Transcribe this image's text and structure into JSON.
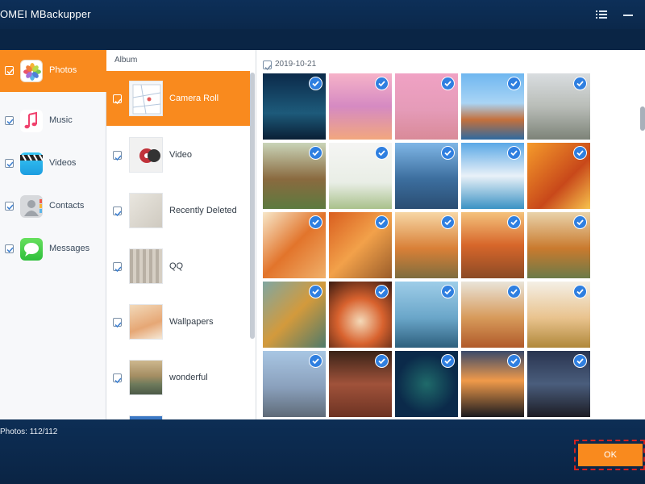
{
  "window": {
    "title": "OMEI MBackupper"
  },
  "icons": {
    "menu": "list-menu-icon",
    "minimize": "minimize-icon"
  },
  "categories": [
    {
      "label": "Photos",
      "icon": "photos-app-icon"
    },
    {
      "label": "Music",
      "icon": "music-note-icon"
    },
    {
      "label": "Videos",
      "icon": "video-clapper-icon"
    },
    {
      "label": "Contacts",
      "icon": "contacts-app-icon"
    },
    {
      "label": "Messages",
      "icon": "messages-bubble-icon"
    }
  ],
  "albums": {
    "header": "Album",
    "items": [
      {
        "label": "Camera Roll"
      },
      {
        "label": "Video"
      },
      {
        "label": "Recently Deleted"
      },
      {
        "label": "QQ"
      },
      {
        "label": "Wallpapers"
      },
      {
        "label": "wonderful"
      }
    ]
  },
  "grid": {
    "date": "2019-10-21",
    "photo_count_visible": 25
  },
  "footer": {
    "count": "Photos: 112/112",
    "ok_label": "OK"
  },
  "colors": {
    "accent": "#f98a1e",
    "title_bar": "#0d2f58",
    "check_badge": "#2f7fe0",
    "highlight_border": "#d12020"
  }
}
